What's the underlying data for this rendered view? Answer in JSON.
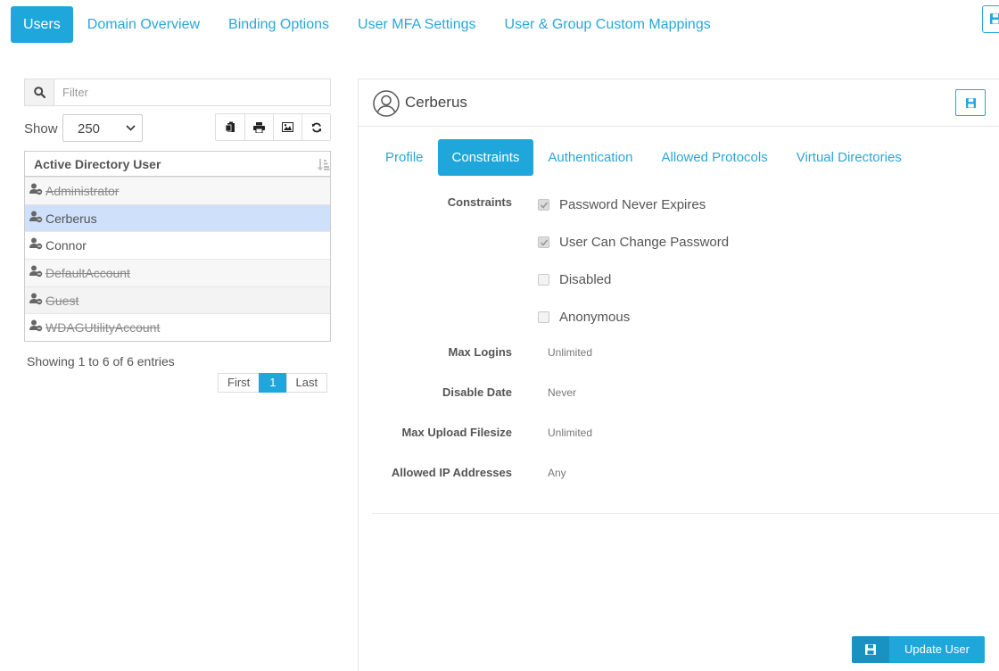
{
  "nav": {
    "tabs": [
      {
        "label": "Users",
        "active": true
      },
      {
        "label": "Domain Overview"
      },
      {
        "label": "Binding Options"
      },
      {
        "label": "User MFA Settings"
      },
      {
        "label": "User & Group Custom Mappings"
      }
    ]
  },
  "left": {
    "filter_placeholder": "Filter",
    "show_label": "Show",
    "show_value": "250",
    "table_header": "Active Directory User",
    "users": [
      {
        "name": "Administrator",
        "disabled": true
      },
      {
        "name": "Cerberus",
        "disabled": false,
        "selected": true
      },
      {
        "name": "Connor",
        "disabled": false
      },
      {
        "name": "DefaultAccount",
        "disabled": true
      },
      {
        "name": "Guest",
        "disabled": true
      },
      {
        "name": "WDAGUtilityAccount",
        "disabled": true
      }
    ],
    "showing_text": "Showing 1 to 6 of 6 entries",
    "pager": {
      "first": "First",
      "page": "1",
      "last": "Last"
    }
  },
  "right": {
    "user_name": "Cerberus",
    "tabs": [
      {
        "label": "Profile"
      },
      {
        "label": "Constraints",
        "active": true
      },
      {
        "label": "Authentication"
      },
      {
        "label": "Allowed Protocols"
      },
      {
        "label": "Virtual Directories"
      }
    ],
    "constraints_label": "Constraints",
    "checkboxes": [
      {
        "label": "Password Never Expires",
        "checked": true
      },
      {
        "label": "User Can Change Password",
        "checked": true
      },
      {
        "label": "Disabled",
        "checked": false
      },
      {
        "label": "Anonymous",
        "checked": false
      }
    ],
    "fields": [
      {
        "label": "Max Logins",
        "value": "Unlimited"
      },
      {
        "label": "Disable Date",
        "value": "Never"
      },
      {
        "label": "Max Upload Filesize",
        "value": "Unlimited"
      },
      {
        "label": "Allowed IP Addresses",
        "value": "Any"
      }
    ],
    "update_button": "Update User"
  },
  "colors": {
    "accent": "#1fa7db",
    "link": "#2aa6d8",
    "selected_row": "#cfe0fb"
  }
}
